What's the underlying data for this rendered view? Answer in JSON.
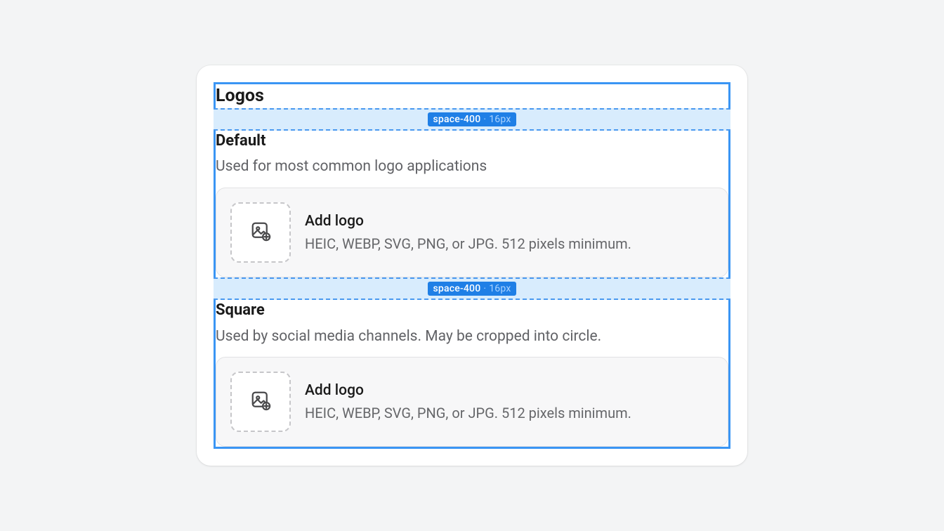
{
  "heading": "Logos",
  "spacer": {
    "token": "space-400",
    "value": "16px"
  },
  "sections": {
    "default": {
      "title": "Default",
      "description": "Used for most common logo applications",
      "drop_label": "Add logo",
      "drop_hint": "HEIC, WEBP, SVG, PNG, or JPG. 512 pixels minimum."
    },
    "square": {
      "title": "Square",
      "description": "Used by social media channels. May be cropped into circle.",
      "drop_label": "Add logo",
      "drop_hint": "HEIC, WEBP, SVG, PNG, or JPG. 512 pixels minimum."
    }
  }
}
